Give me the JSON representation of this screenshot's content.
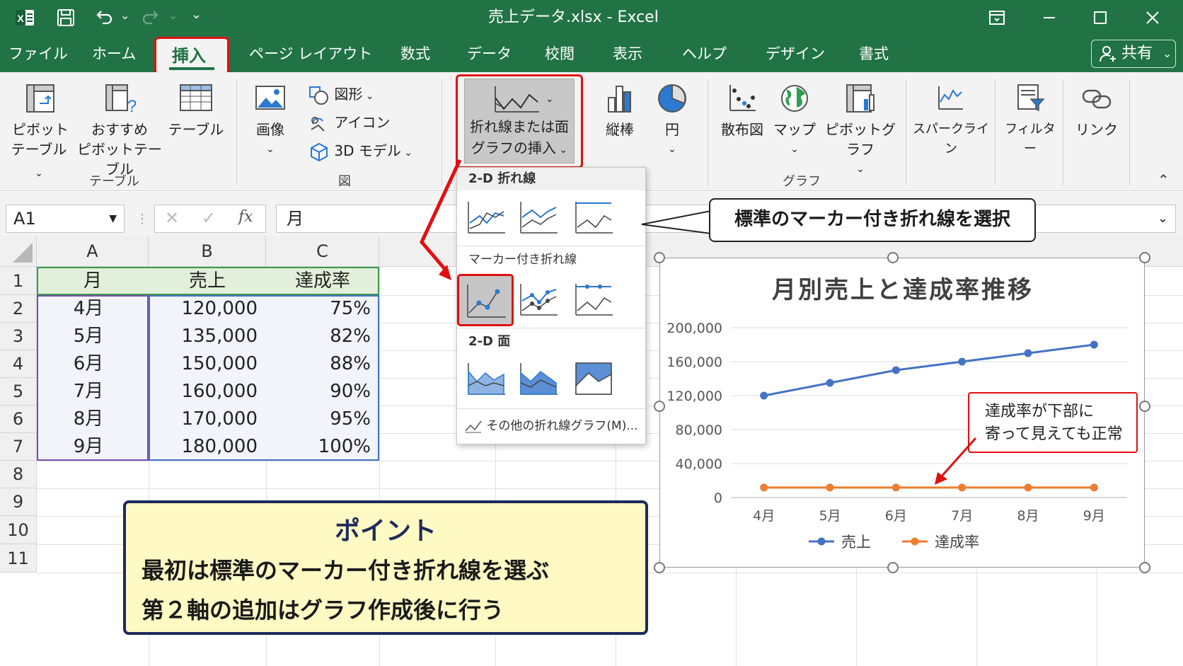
{
  "window": {
    "title": "売上データ.xlsx  -  Excel",
    "share_label": "共有"
  },
  "tabs": [
    "ファイル",
    "ホーム",
    "挿入",
    "ページ レイアウト",
    "数式",
    "データ",
    "校閲",
    "表示",
    "ヘルプ",
    "デザイン",
    "書式"
  ],
  "ribbon": {
    "pivot_table": [
      "ピボット",
      "テーブル"
    ],
    "recommended_pivot": [
      "おすすめ",
      "ピボットテーブル"
    ],
    "table": "テーブル",
    "group_table": "テーブル",
    "image": "画像",
    "shapes": "図形",
    "icons": "アイコン",
    "model3d": "3D モデル",
    "group_figure": "図",
    "line_area": [
      "折れ線または面",
      "グラフの挿入"
    ],
    "column": "縦棒",
    "pie": "円",
    "scatter": "散布図",
    "map": "マップ",
    "pivot_chart": "ピボットグラフ",
    "group_chart": "グラフ",
    "sparkline": "スパークライン",
    "filter": "フィルター",
    "link": "リンク"
  },
  "formula_bar": {
    "name_box": "A1",
    "fx": "fx",
    "value": "月"
  },
  "dropdown": {
    "sec1": "2-D 折れ線",
    "sec2": "マーカー付き折れ線",
    "sec3": "2-D 面",
    "more": "その他の折れ線グラフ(M)..."
  },
  "callout_top": "標準のマーカー付き折れ線を選択",
  "sheet": {
    "columns": [
      "A",
      "B",
      "C"
    ],
    "rows": [
      "1",
      "2",
      "3",
      "4",
      "5",
      "6",
      "7",
      "8",
      "9",
      "10",
      "11"
    ],
    "header": [
      "月",
      "売上",
      "達成率"
    ],
    "data": [
      [
        "4月",
        "120,000",
        "75%"
      ],
      [
        "5月",
        "135,000",
        "82%"
      ],
      [
        "6月",
        "150,000",
        "88%"
      ],
      [
        "7月",
        "160,000",
        "90%"
      ],
      [
        "8月",
        "170,000",
        "95%"
      ],
      [
        "9月",
        "180,000",
        "100%"
      ]
    ]
  },
  "point_box": {
    "heading": "ポイント",
    "line1": "最初は標準のマーカー付き折れ線を選ぶ",
    "line2": "第２軸の追加はグラフ作成後に行う"
  },
  "chart_callout": [
    "達成率が下部に",
    "寄って見えても正常"
  ],
  "colors": {
    "excel_green": "#217346",
    "highlight_red": "#e01010",
    "series_sales": "#4472c4",
    "series_rate": "#ed7d31"
  },
  "chart_data": {
    "type": "line",
    "title": "月別売上と達成率推移",
    "categories": [
      "4月",
      "5月",
      "6月",
      "7月",
      "8月",
      "9月"
    ],
    "series": [
      {
        "name": "売上",
        "values": [
          120000,
          135000,
          150000,
          160000,
          170000,
          180000
        ]
      },
      {
        "name": "達成率",
        "values": [
          75,
          82,
          88,
          90,
          95,
          100
        ]
      }
    ],
    "ylim": [
      0,
      200000
    ],
    "yticks": [
      "200,000",
      "160,000",
      "120,000",
      "80,000",
      "40,000",
      "0"
    ],
    "legend": "bottom",
    "grid": true
  }
}
